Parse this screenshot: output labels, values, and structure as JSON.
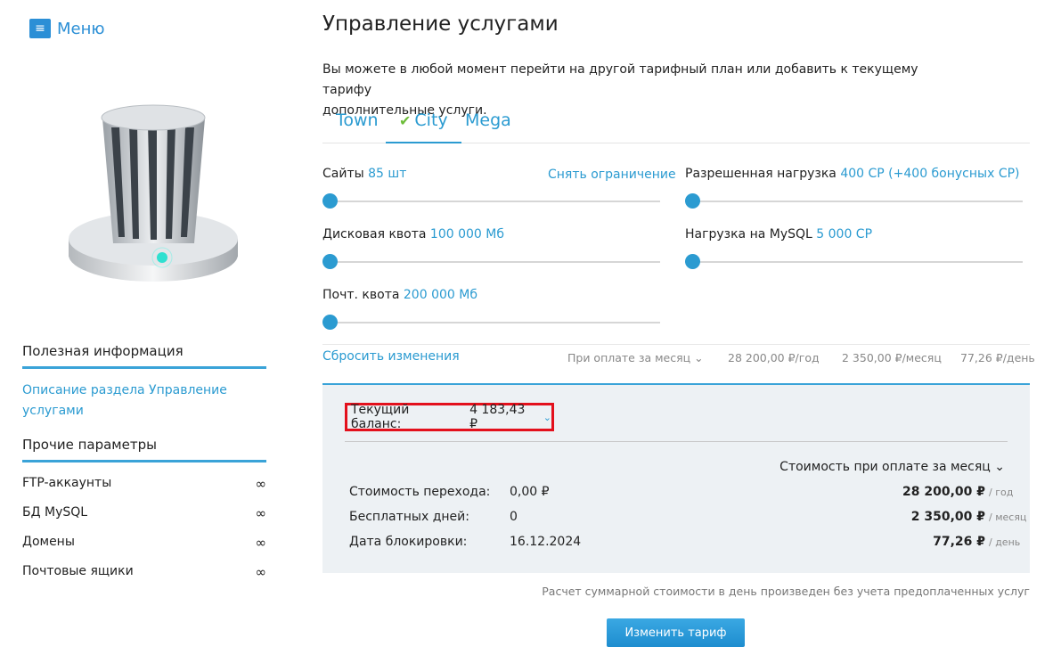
{
  "menu": {
    "label": "Меню"
  },
  "page": {
    "title": "Управление услугами",
    "intro_line1": "Вы можете в любой момент перейти на другой тарифный план или добавить к текущему тарифу",
    "intro_line2": "дополнительные услуги."
  },
  "tabs": [
    {
      "label": "Town",
      "active": false
    },
    {
      "label": "City",
      "active": true
    },
    {
      "label": "Mega",
      "active": false
    }
  ],
  "sliders": {
    "sites": {
      "label": "Сайты",
      "value": "85 шт",
      "level": 0
    },
    "remove_limit": "Снять ограничение",
    "load": {
      "label": "Разрешенная нагрузка",
      "value": "400 CP (+400 бонусных CP)",
      "level": 0
    },
    "disk": {
      "label": "Дисковая квота",
      "value": "100 000 Мб",
      "level": 0
    },
    "mysql": {
      "label": "Нагрузка на MySQL",
      "value": "5 000 CP",
      "level": 0
    },
    "mail": {
      "label": "Почт. квота",
      "value": "200 000 Мб",
      "level": 0
    }
  },
  "summary": {
    "reset": "Сбросить изменения",
    "period": "При оплате за месяц",
    "per_year": "28 200,00 ₽/год",
    "per_month": "2 350,00 ₽/месяц",
    "per_day": "77,26 ₽/день"
  },
  "balance": {
    "label": "Текущий баланс:",
    "amount": "4 183,43 ₽"
  },
  "cost": {
    "dropdown": "Стоимость при оплате за месяц",
    "rows": [
      {
        "key": "Стоимость перехода:",
        "value": "0,00 ₽",
        "price": "28 200,00 ₽",
        "per": "/ год"
      },
      {
        "key": "Бесплатных дней:",
        "value": "0",
        "price": "2 350,00 ₽",
        "per": "/ месяц"
      },
      {
        "key": "Дата блокировки:",
        "value": "16.12.2024",
        "price": "77,26 ₽",
        "per": "/ день"
      }
    ]
  },
  "note": "Расчет суммарной стоимости в день произведен без учета предоплаченных услуг",
  "button": "Изменить тариф",
  "sidebar": {
    "useful_title": "Полезная информация",
    "useful_link": "Описание раздела Управление услугами",
    "params_title": "Прочие параметры",
    "params": [
      {
        "name": "FTP-аккаунты",
        "value": "∞"
      },
      {
        "name": "БД MySQL",
        "value": "∞"
      },
      {
        "name": "Домены",
        "value": "∞"
      },
      {
        "name": "Почтовые ящики",
        "value": "∞"
      }
    ]
  },
  "colors": {
    "accent": "#2b9bd1",
    "highlight": "#e3101c",
    "check": "#6dbd3a"
  }
}
